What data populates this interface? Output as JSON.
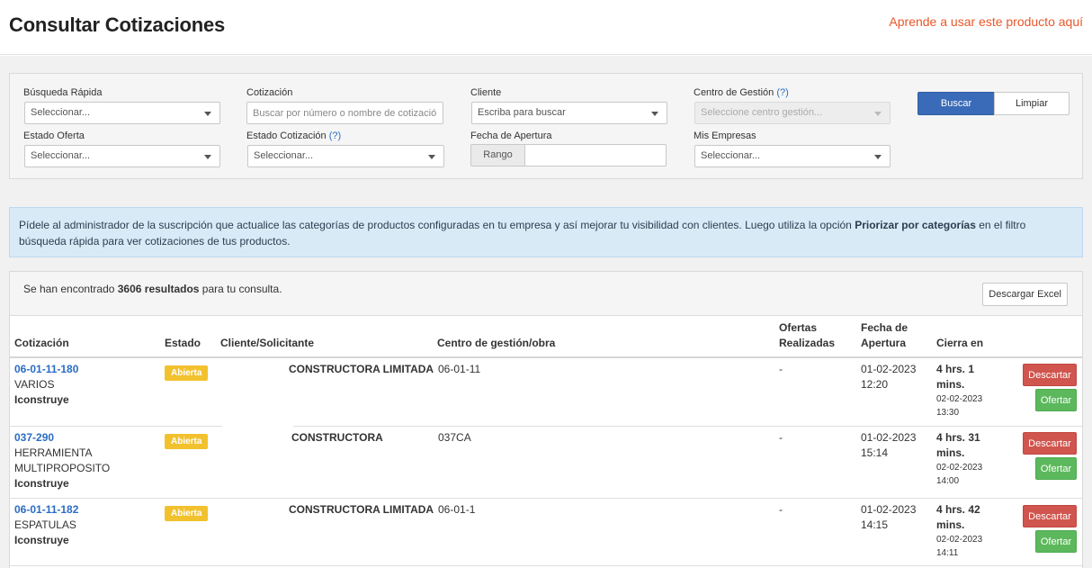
{
  "header": {
    "title": "Consultar Cotizaciones",
    "help_link": "Aprende a usar este producto aquí"
  },
  "filters": {
    "busqueda_rapida": {
      "label": "Búsqueda Rápida",
      "value": "Seleccionar..."
    },
    "cotizacion": {
      "label": "Cotización",
      "placeholder": "Buscar por número o nombre de cotización"
    },
    "cliente": {
      "label": "Cliente",
      "value": "Escriba para buscar"
    },
    "centro_gestion": {
      "label": "Centro de Gestión",
      "help": "(?)",
      "value": "Seleccione centro gestión..."
    },
    "estado_oferta": {
      "label": "Estado Oferta",
      "value": "Seleccionar..."
    },
    "estado_cotizacion": {
      "label": "Estado Cotización",
      "help": "(?)",
      "value": "Seleccionar..."
    },
    "fecha_apertura": {
      "label": "Fecha de Apertura",
      "range_label": "Rango",
      "value": ""
    },
    "mis_empresas": {
      "label": "Mis Empresas",
      "value": "Seleccionar..."
    },
    "buscar_label": "Buscar",
    "limpiar_label": "Limpiar"
  },
  "info": {
    "text_before": "Pídele al administrador de la suscripción que actualice las categorías de productos configuradas en tu empresa y así mejorar tu visibilidad con clientes. Luego utiliza la opción ",
    "text_bold": "Priorizar por categorías",
    "text_after": " en el filtro búsqueda rápida para ver cotizaciones de tus productos."
  },
  "results": {
    "count_before": "Se han encontrado ",
    "count_bold": "3606 resultados",
    "count_after": " para tu consulta.",
    "excel_label": "Descargar Excel",
    "columns": {
      "cotizacion": "Cotización",
      "estado": "Estado",
      "cliente": "Cliente/Solicitante",
      "centro": "Centro de gestión/obra",
      "ofertas_1": "Ofertas",
      "ofertas_2": "Realizadas",
      "fecha_1": "Fecha de",
      "fecha_2": "Apertura",
      "cierra": "Cierra en"
    },
    "rows": [
      {
        "code": "06-01-11-180",
        "desc": [
          "VARIOS"
        ],
        "company": "Iconstruye",
        "estado": "Abierta",
        "cliente": "CONSTRUCTORA LIMITADA",
        "centro": "06-01-11",
        "ofertas": "-",
        "fecha_date": "01-02-2023",
        "fecha_time": "12:20",
        "cierra_1": "4 hrs. 1",
        "cierra_2": "mins.",
        "cierra_date": "02-02-2023",
        "cierra_time": "13:30",
        "descartar": "Descartar",
        "ofertar": "Ofertar"
      },
      {
        "code": "037-290",
        "desc": [
          "HERRAMIENTA",
          "MULTIPROPOSITO"
        ],
        "company": "Iconstruye",
        "estado": "Abierta",
        "cliente": "CONSTRUCTORA",
        "centro": "037CA",
        "ofertas": "-",
        "fecha_date": "01-02-2023",
        "fecha_time": "15:14",
        "cierra_1": "4 hrs. 31",
        "cierra_2": "mins.",
        "cierra_date": "02-02-2023",
        "cierra_time": "14:00",
        "descartar": "Descartar",
        "ofertar": "Ofertar"
      },
      {
        "code": "06-01-11-182",
        "desc": [
          "ESPATULAS"
        ],
        "company": "Iconstruye",
        "estado": "Abierta",
        "cliente": "CONSTRUCTORA LIMITADA",
        "centro": "06-01-1",
        "ofertas": "-",
        "fecha_date": "01-02-2023",
        "fecha_time": "14:15",
        "cierra_1": "4 hrs. 42",
        "cierra_2": "mins.",
        "cierra_date": "02-02-2023",
        "cierra_time": "14:11",
        "descartar": "Descartar",
        "ofertar": "Ofertar"
      }
    ]
  },
  "colors": {
    "accent_blue": "#3a6bb8",
    "link_blue": "#2b6cc4",
    "help_orange": "#e8572a",
    "badge_yellow": "#f2c12e",
    "descartar_red": "#d0554e",
    "ofertar_green": "#5cb85c"
  }
}
